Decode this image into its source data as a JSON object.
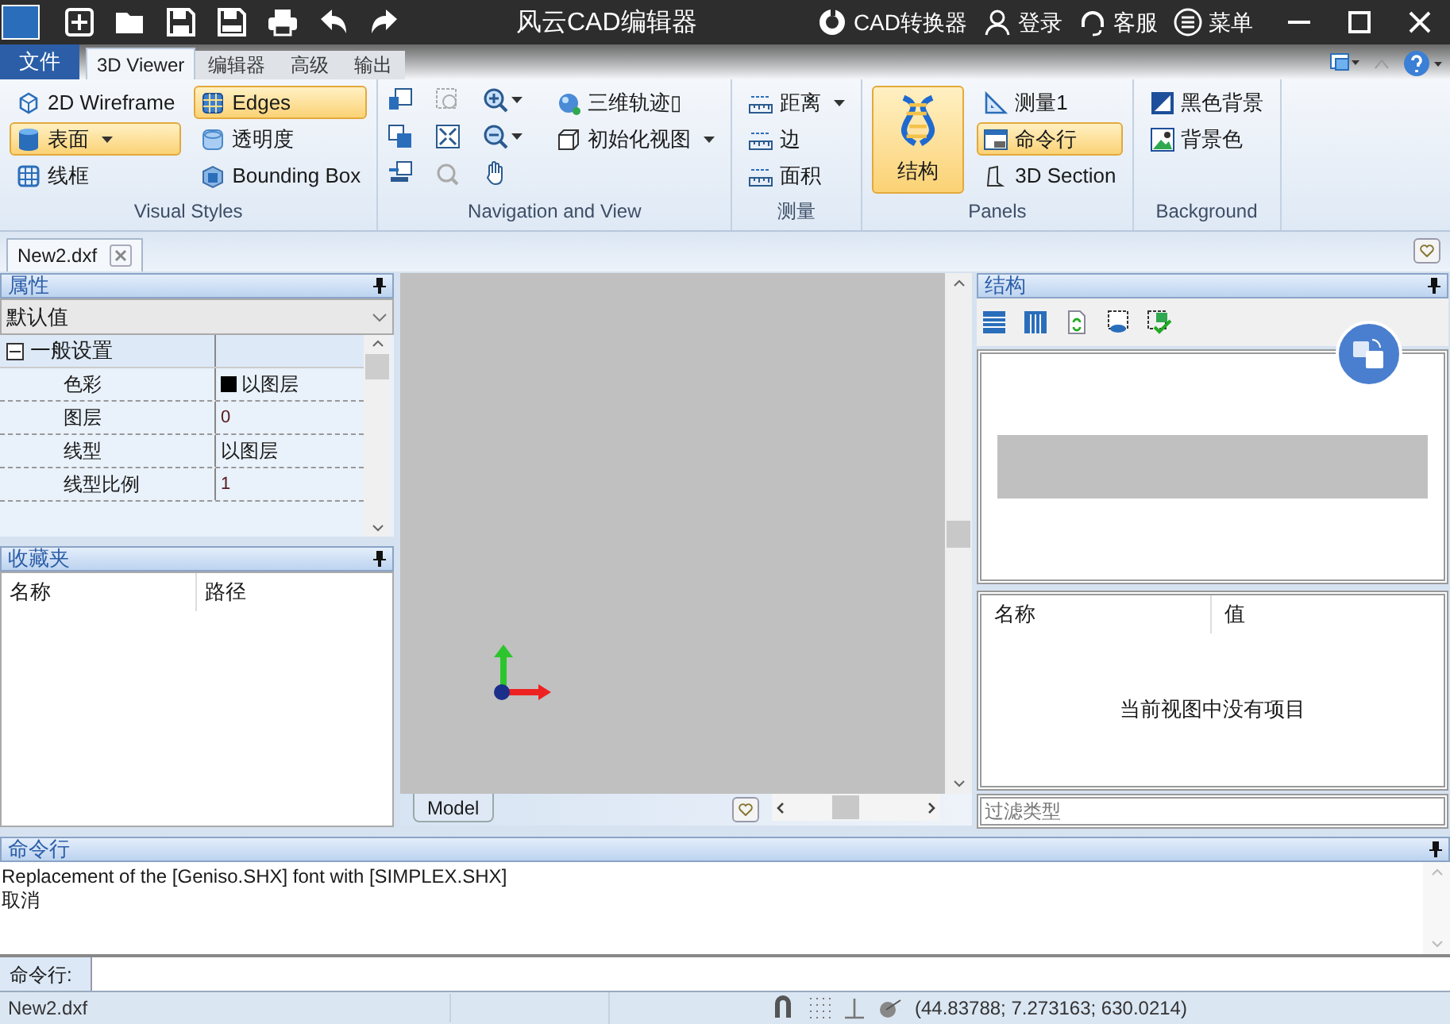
{
  "title_bar": {
    "title": "风云CAD编辑器",
    "actions": [
      {
        "label": "CAD转换器"
      },
      {
        "label": "登录"
      },
      {
        "label": "客服"
      },
      {
        "label": "菜单"
      }
    ]
  },
  "ribbon_tabs": [
    {
      "label": "文件",
      "kind": "file",
      "selected": false
    },
    {
      "label": "3D Viewer",
      "kind": "tab",
      "selected": true
    },
    {
      "label": "编辑器",
      "kind": "tab",
      "selected": false
    },
    {
      "label": "高级",
      "kind": "tab",
      "selected": false
    },
    {
      "label": "输出",
      "kind": "tab",
      "selected": false
    }
  ],
  "ribbon_groups": [
    {
      "title": "Visual Styles",
      "kind": "standard",
      "columns": [
        [
          {
            "label": "2D Wireframe",
            "kind": "small",
            "on": false,
            "dropdown": false
          },
          {
            "label": "表面",
            "kind": "small",
            "on": true,
            "dropdown": true
          },
          {
            "label": "线框",
            "kind": "small",
            "on": false,
            "dropdown": false
          }
        ],
        [
          {
            "label": "Edges",
            "kind": "small",
            "on": true,
            "dropdown": false
          },
          {
            "label": "透明度",
            "kind": "small",
            "on": false,
            "dropdown": false
          },
          {
            "label": "Bounding Box",
            "kind": "small",
            "on": false,
            "dropdown": false
          }
        ]
      ]
    },
    {
      "title": "Navigation and View",
      "kind": "navigation",
      "columns": [
        [
          {
            "label": "三维轨迹▯",
            "kind": "small",
            "on": false,
            "dropdown": false
          },
          {
            "label": "初始化视图",
            "kind": "small",
            "on": false,
            "dropdown": true
          }
        ]
      ]
    },
    {
      "title": "测量",
      "kind": "standard",
      "columns": [
        [
          {
            "label": "距离",
            "kind": "small",
            "on": false,
            "dropdown": true
          },
          {
            "label": "边",
            "kind": "small",
            "on": false,
            "dropdown": false
          },
          {
            "label": "面积",
            "kind": "small",
            "on": false,
            "dropdown": false
          }
        ]
      ]
    },
    {
      "title": "Panels",
      "kind": "standard",
      "columns": [
        [
          {
            "label": "结构",
            "kind": "large",
            "on": true,
            "dropdown": false
          }
        ],
        [
          {
            "label": "测量1",
            "kind": "small",
            "on": false,
            "dropdown": false
          },
          {
            "label": "命令行",
            "kind": "small",
            "on": true,
            "dropdown": false
          },
          {
            "label": "3D Section",
            "kind": "small",
            "on": false,
            "dropdown": false
          }
        ]
      ]
    },
    {
      "title": "Background",
      "kind": "standard",
      "columns": [
        [
          {
            "label": "黑色背景",
            "kind": "small",
            "on": false,
            "dropdown": false
          },
          {
            "label": "背景色",
            "kind": "small",
            "on": false,
            "dropdown": false
          }
        ]
      ]
    }
  ],
  "document_tabs": [
    {
      "label": "New2.dxf",
      "selected": true
    }
  ],
  "properties_panel": {
    "title": "属性",
    "preset": "默认值",
    "category": {
      "label": "一般设置",
      "expanded": true
    },
    "rows": [
      {
        "name": "色彩",
        "value": "以图层",
        "kind": "color"
      },
      {
        "name": "图层",
        "value": "0",
        "kind": "text"
      },
      {
        "name": "线型",
        "value": "以图层",
        "kind": "text"
      },
      {
        "name": "线型比例",
        "value": "1",
        "kind": "text"
      }
    ]
  },
  "favorites_panel": {
    "title": "收藏夹",
    "columns": [
      "名称",
      "路径"
    ]
  },
  "viewport": {
    "tabs": [
      {
        "label": "Model",
        "selected": true
      }
    ]
  },
  "structure_panel": {
    "title": "结构",
    "columns": [
      "名称",
      "值"
    ],
    "empty_message": "当前视图中没有项目",
    "filter_placeholder": "过滤类型"
  },
  "command_panel": {
    "title": "命令行",
    "log": [
      "Replacement of the [Geniso.SHX] font with [SIMPLEX.SHX]",
      "取消"
    ],
    "prompt": "命令行:"
  },
  "status_bar": {
    "file": "New2.dxf",
    "coordinates": "(44.83788; 7.273163; 630.0214)"
  }
}
